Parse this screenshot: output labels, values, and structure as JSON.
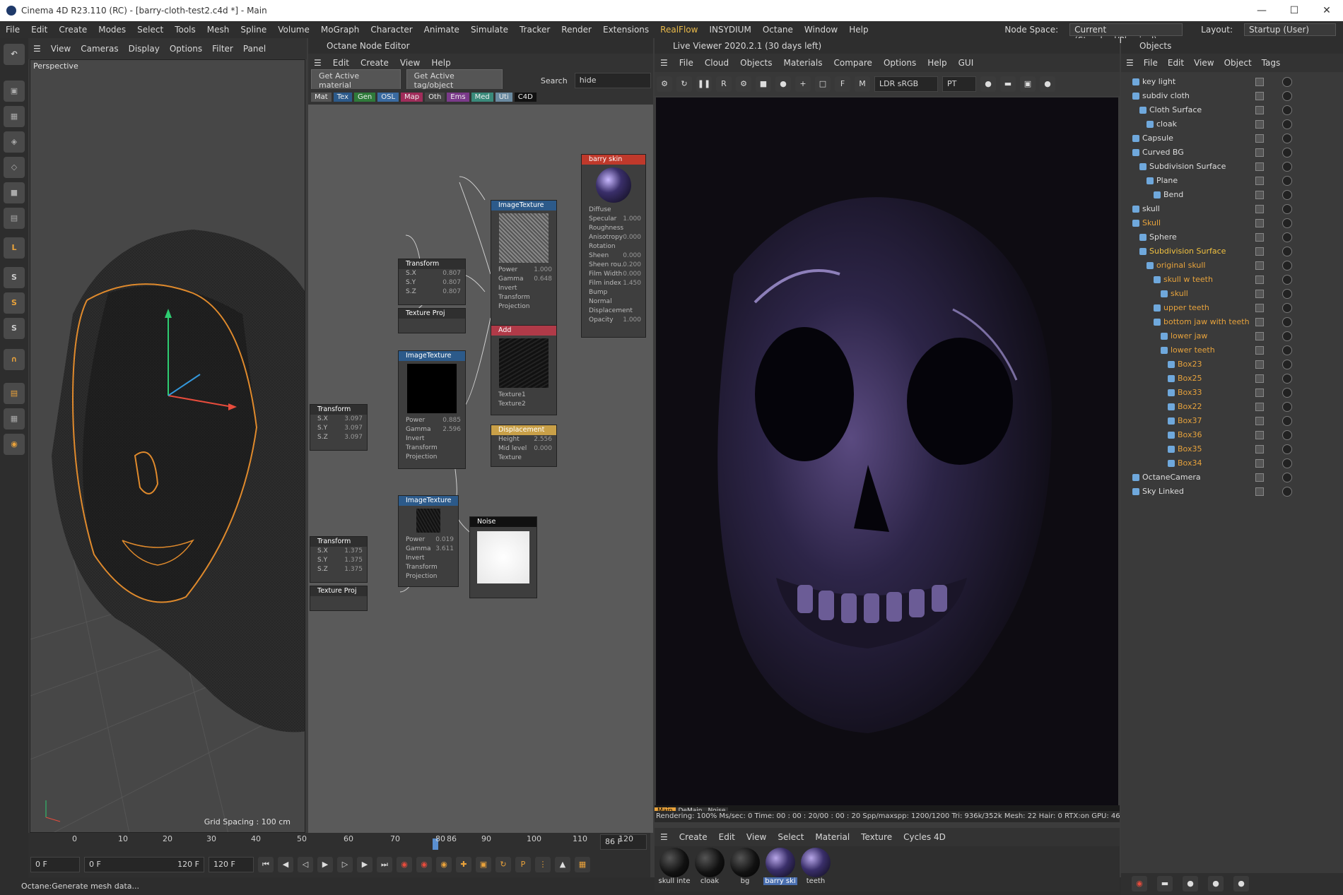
{
  "window": {
    "title": "Cinema 4D R23.110 (RC) - [barry-cloth-test2.c4d *] - Main"
  },
  "menubar": {
    "items": [
      "File",
      "Edit",
      "Create",
      "Modes",
      "Select",
      "Tools",
      "Mesh",
      "Spline",
      "Volume",
      "MoGraph",
      "Character",
      "Animate",
      "Simulate",
      "Tracker",
      "Render",
      "Extensions",
      "RealFlow",
      "INSYDIUM",
      "Octane",
      "Window",
      "Help"
    ],
    "node_space_label": "Node Space:",
    "node_space_value": "Current (Standard/Physical)",
    "layout_label": "Layout:",
    "layout_value": "Startup (User)"
  },
  "viewport": {
    "menu": [
      "View",
      "Cameras",
      "Display",
      "Options",
      "Filter",
      "Panel"
    ],
    "label": "Perspective",
    "grid": "Grid Spacing : 100 cm"
  },
  "timeline": {
    "ticks": [
      "0",
      "10",
      "20",
      "30",
      "40",
      "50",
      "60",
      "70",
      "80",
      "86",
      "90",
      "100",
      "110",
      "120"
    ],
    "current": "86 F",
    "start": "0 F",
    "range_start": "0 F",
    "range_end": "120 F",
    "end": "120 F"
  },
  "status": "Octane:Generate mesh data...",
  "node_editor": {
    "title": "Octane Node Editor",
    "menu": [
      "Edit",
      "Create",
      "View",
      "Help"
    ],
    "get_active_material": "Get Active material",
    "get_active_tag": "Get Active tag/object",
    "search_label": "Search",
    "search_value": "hide",
    "cats": [
      "Mat",
      "Tex",
      "Gen",
      "OSL",
      "Map",
      "Oth",
      "Ems",
      "Med",
      "Uti",
      "C4D"
    ]
  },
  "nodes": {
    "barry_skin": {
      "title": "barry skin",
      "props": [
        "Diffuse",
        "Specular",
        "Roughness",
        "Anisotropy",
        "Rotation",
        "Sheen",
        "Sheen rou..",
        "Film Width",
        "Film index",
        "Bump",
        "Normal",
        "Displacement",
        "Opacity"
      ],
      "vals": [
        "",
        "1.000",
        "",
        "0.000",
        "",
        "0.000",
        "0.200",
        "0.000",
        "1.450",
        "",
        "",
        "",
        "1.000"
      ]
    },
    "img1": {
      "title": "ImageTexture",
      "props": [
        "Power",
        "Gamma",
        "Invert",
        "Transform",
        "Projection"
      ],
      "vals": [
        "1.000",
        "0.648",
        "",
        "",
        ""
      ]
    },
    "tr1": {
      "title": "Transform",
      "props": [
        "S.X",
        "S.Y",
        "S.Z"
      ],
      "vals": [
        "0.807",
        "0.807",
        "0.807"
      ]
    },
    "tp1": {
      "title": "Texture Proj"
    },
    "add": {
      "title": "Add",
      "props": [
        "Texture1",
        "Texture2"
      ]
    },
    "img2": {
      "title": "ImageTexture",
      "props": [
        "Power",
        "Gamma",
        "Invert",
        "Transform",
        "Projection"
      ],
      "vals": [
        "0.885",
        "2.596",
        "",
        "",
        ""
      ]
    },
    "tr2": {
      "title": "Transform",
      "props": [
        "S.X",
        "S.Y",
        "S.Z"
      ],
      "vals": [
        "3.097",
        "3.097",
        "3.097"
      ]
    },
    "disp": {
      "title": "Displacement",
      "props": [
        "Height",
        "Mid level",
        "Texture"
      ],
      "vals": [
        "2.556",
        "0.000",
        ""
      ]
    },
    "img3": {
      "title": "ImageTexture",
      "props": [
        "Power",
        "Gamma",
        "Invert",
        "Transform",
        "Projection"
      ],
      "vals": [
        "0.019",
        "3.611",
        "",
        "",
        ""
      ]
    },
    "noise": {
      "title": "Noise"
    },
    "tr3": {
      "title": "Transform",
      "props": [
        "S.X",
        "S.Y",
        "S.Z"
      ],
      "vals": [
        "1.375",
        "1.375",
        "1.375"
      ]
    },
    "tp2": {
      "title": "Texture Proj"
    }
  },
  "live_viewer": {
    "title": "Live Viewer 2020.2.1 (30 days left)",
    "menu": [
      "File",
      "Cloud",
      "Objects",
      "Materials",
      "Compare",
      "Options",
      "Help",
      "GUI"
    ],
    "ldr": "LDR sRGB",
    "pt": "PT",
    "tabs": [
      "Main",
      "DeMain",
      "Noise"
    ],
    "info": "Rendering: 100%  Ms/sec: 0   Time: 00 : 00 : 20/00 : 00 : 20  Spp/maxspp: 1200/1200   Tri: 936k/352k  Mesh: 22   Hair: 0   RTX:on     GPU:    46"
  },
  "materials": {
    "menu": [
      "Create",
      "Edit",
      "View",
      "Select",
      "Material",
      "Texture",
      "Cycles 4D"
    ],
    "items": [
      "skull inte",
      "cloak",
      "bg",
      "barry ski",
      "teeth"
    ]
  },
  "objects": {
    "title": "Objects",
    "menu": [
      "File",
      "Edit",
      "View",
      "Object",
      "Tags"
    ],
    "rows": [
      {
        "n": "key light",
        "d": 0,
        "c": "#ddd"
      },
      {
        "n": "subdiv cloth",
        "d": 0,
        "c": "#ddd"
      },
      {
        "n": "Cloth Surface",
        "d": 1,
        "c": "#ddd"
      },
      {
        "n": "cloak",
        "d": 2,
        "c": "#ddd"
      },
      {
        "n": "Capsule",
        "d": 0,
        "c": "#ddd"
      },
      {
        "n": "Curved BG",
        "d": 0,
        "c": "#ddd"
      },
      {
        "n": "Subdivision Surface",
        "d": 1,
        "c": "#ddd"
      },
      {
        "n": "Plane",
        "d": 2,
        "c": "#ddd"
      },
      {
        "n": "Bend",
        "d": 3,
        "c": "#ddd"
      },
      {
        "n": "skull",
        "d": 0,
        "c": "#ddd"
      },
      {
        "n": "Skull",
        "d": 0,
        "c": "#e6a23c"
      },
      {
        "n": "Sphere",
        "d": 1,
        "c": "#ddd"
      },
      {
        "n": "Subdivision Surface",
        "d": 1,
        "c": "#f0c040"
      },
      {
        "n": "original skull",
        "d": 2,
        "c": "#e6a23c"
      },
      {
        "n": "skull w teeth",
        "d": 3,
        "c": "#e6a23c"
      },
      {
        "n": "skull",
        "d": 4,
        "c": "#e6a23c"
      },
      {
        "n": "upper teeth",
        "d": 3,
        "c": "#e6a23c"
      },
      {
        "n": "bottom jaw with teeth",
        "d": 3,
        "c": "#e6a23c"
      },
      {
        "n": "lower jaw",
        "d": 4,
        "c": "#e6a23c"
      },
      {
        "n": "lower teeth",
        "d": 4,
        "c": "#e6a23c"
      },
      {
        "n": "Box23",
        "d": 5,
        "c": "#e6a23c"
      },
      {
        "n": "Box25",
        "d": 5,
        "c": "#e6a23c"
      },
      {
        "n": "Box33",
        "d": 5,
        "c": "#e6a23c"
      },
      {
        "n": "Box22",
        "d": 5,
        "c": "#e6a23c"
      },
      {
        "n": "Box37",
        "d": 5,
        "c": "#e6a23c"
      },
      {
        "n": "Box36",
        "d": 5,
        "c": "#e6a23c"
      },
      {
        "n": "Box35",
        "d": 5,
        "c": "#e6a23c"
      },
      {
        "n": "Box34",
        "d": 5,
        "c": "#e6a23c"
      },
      {
        "n": "OctaneCamera",
        "d": 0,
        "c": "#ddd"
      },
      {
        "n": "Sky Linked",
        "d": 0,
        "c": "#ddd"
      }
    ]
  }
}
